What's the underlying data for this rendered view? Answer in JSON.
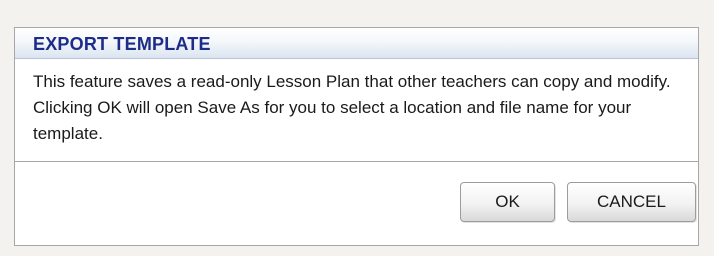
{
  "dialog": {
    "title": "EXPORT TEMPLATE",
    "message": "This feature saves a read-only Lesson Plan that other teachers can copy and modify. Clicking OK will open Save As for you to select a location and file name for your template.",
    "buttons": {
      "ok_label": "OK",
      "cancel_label": "CANCEL"
    }
  },
  "colors": {
    "title_text": "#1d2c88",
    "title_bar_gradient_bottom": "#dbe5f1",
    "border": "#a7a7a7",
    "page_background": "#f3f2ee"
  }
}
